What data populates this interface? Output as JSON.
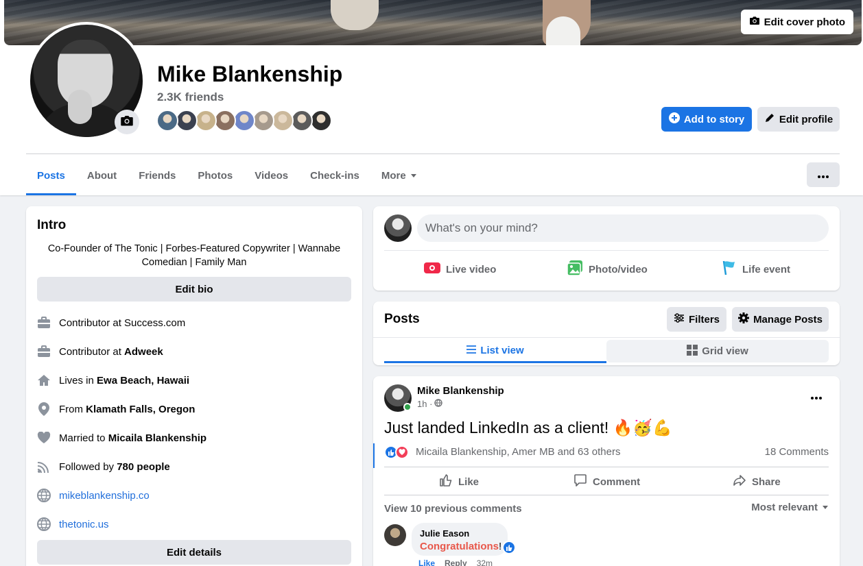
{
  "cover": {
    "edit_label": "Edit cover photo"
  },
  "profile": {
    "name": "Mike Blankenship",
    "friends_count": "2.3K friends",
    "friend_avatar_colors": [
      "#4b6a86",
      "#3b4150",
      "#c7b28b",
      "#8a7060",
      "#6f86c9",
      "#a69a8d",
      "#cbb89b",
      "#5b5b5b",
      "#2f2f2f"
    ],
    "add_story_label": "Add to story",
    "edit_profile_label": "Edit profile"
  },
  "tabs": [
    "Posts",
    "About",
    "Friends",
    "Photos",
    "Videos",
    "Check-ins",
    "More"
  ],
  "intro": {
    "title": "Intro",
    "bio": "Co-Founder of The Tonic | Forbes-Featured Copywriter | Wannabe Comedian | Family Man",
    "edit_bio_label": "Edit bio",
    "details": [
      {
        "icon": "briefcase-icon",
        "prefix": "Contributor at Success.com",
        "bold": ""
      },
      {
        "icon": "briefcase-icon",
        "prefix": "Contributor at ",
        "bold": "Adweek"
      },
      {
        "icon": "home-icon",
        "prefix": "Lives in ",
        "bold": "Ewa Beach, Hawaii"
      },
      {
        "icon": "location-pin-icon",
        "prefix": "From ",
        "bold": "Klamath Falls, Oregon"
      },
      {
        "icon": "heart-icon",
        "prefix": "Married to ",
        "bold": "Micaila Blankenship"
      },
      {
        "icon": "rss-icon",
        "prefix": "Followed by ",
        "bold": "780 people"
      }
    ],
    "links": [
      "mikeblankenship.co",
      "thetonic.us"
    ],
    "edit_details_label": "Edit details"
  },
  "composer": {
    "placeholder": "What's on your mind?",
    "live_video": "Live video",
    "photo_video": "Photo/video",
    "life_event": "Life event"
  },
  "posts_header": {
    "title": "Posts",
    "filters": "Filters",
    "manage": "Manage Posts",
    "list_view": "List view",
    "grid_view": "Grid view"
  },
  "post": {
    "author": "Mike Blankenship",
    "time": "1h ·",
    "text": "Just landed LinkedIn as a client! 🔥🥳💪",
    "reactions": "Micaila Blankenship, Amer MB and 63 others",
    "comments": "18 Comments",
    "like": "Like",
    "comment": "Comment",
    "share": "Share",
    "view_previous": "View 10 previous comments",
    "most_relevant": "Most relevant",
    "first_comment": {
      "author": "Julie Eason",
      "text": "Congratulations",
      "suffix": "!",
      "like": "Like",
      "reply": "Reply",
      "time": "32m"
    }
  }
}
